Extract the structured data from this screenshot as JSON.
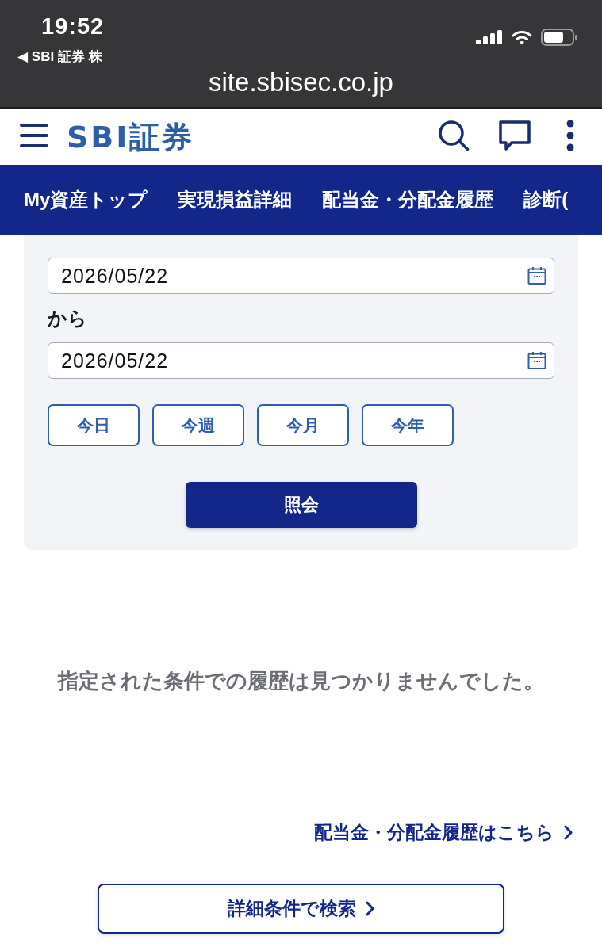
{
  "status_bar": {
    "time": "19:52",
    "back_label": "◀ SBI 証券 株",
    "url": "site.sbisec.co.jp"
  },
  "header": {
    "logo": "SBI証券"
  },
  "nav_tabs": [
    {
      "label": "My資産トップ",
      "selected": false
    },
    {
      "label": "実現損益詳細",
      "selected": false
    },
    {
      "label": "配当金・分配金履歴",
      "selected": false
    },
    {
      "label": "診断(",
      "selected": false
    }
  ],
  "form": {
    "date_from": "2026/05/22",
    "range_word": "から",
    "date_to": "2026/05/22",
    "quick_ranges": [
      "今日",
      "今週",
      "今月",
      "今年"
    ],
    "submit": "照会"
  },
  "message": "指定された条件での履歴は見つかりませんでした。",
  "history_link": "配当金・分配金履歴はこちら",
  "search_button": "詳細条件で検索"
}
